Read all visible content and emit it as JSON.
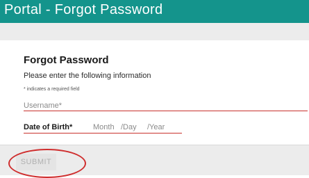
{
  "header": {
    "title": "Portal - Forgot Password"
  },
  "form": {
    "title": "Forgot Password",
    "instructions": "Please enter the following information",
    "required_note": "* indicates a required field",
    "username": {
      "label": "Username*",
      "value": ""
    },
    "date_of_birth": {
      "label": "Date of Birth*",
      "month_placeholder": "Month",
      "day_placeholder": "/Day",
      "year_placeholder": "/Year"
    }
  },
  "footer": {
    "submit_label": "SUBMIT"
  },
  "colors": {
    "header_bg": "#14948c",
    "field_underline": "#c8312c",
    "highlight_annotation": "#cf2e2e"
  }
}
